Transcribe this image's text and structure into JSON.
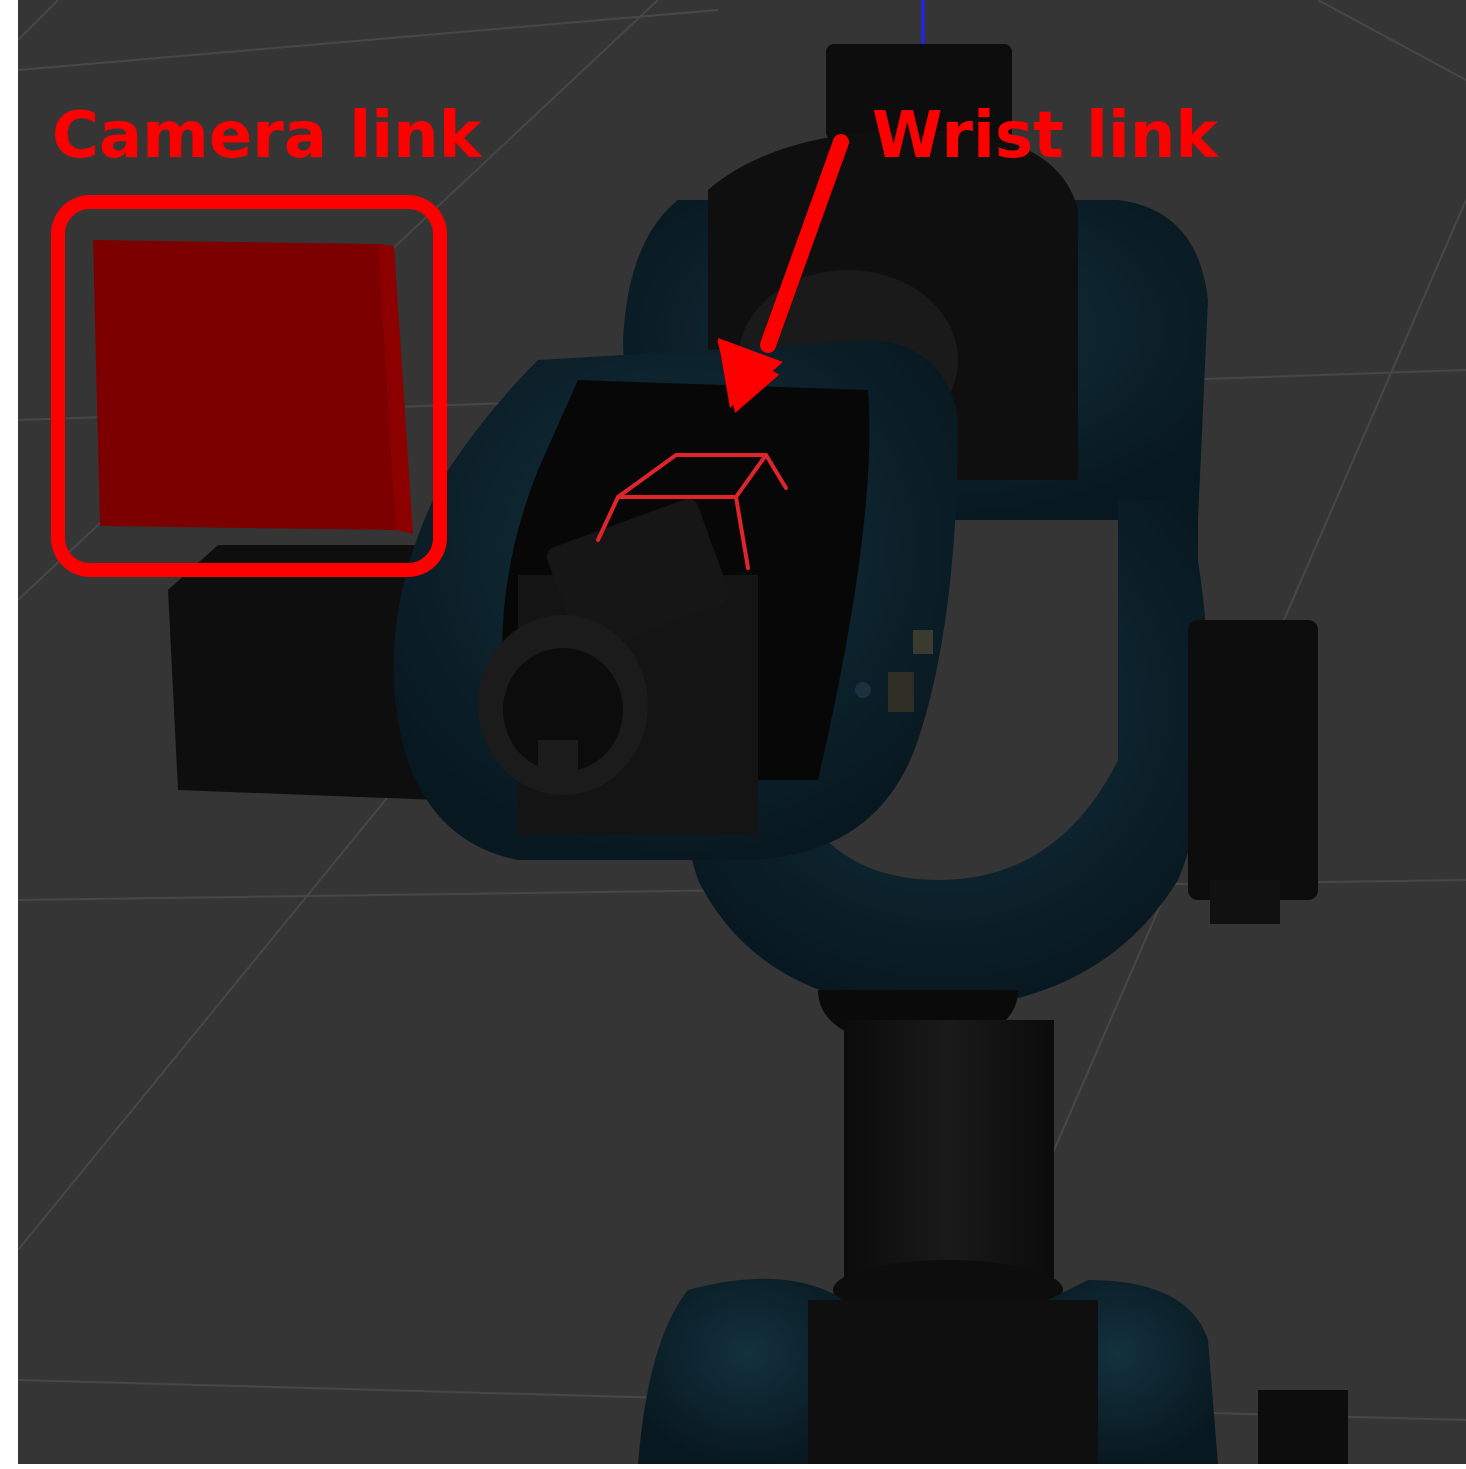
{
  "annotations": {
    "camera_link_label": "Camera link",
    "wrist_link_label": "Wrist link"
  },
  "colors": {
    "annotation": "#ff0000",
    "background": "#353535",
    "robot_shell": "#0f2732",
    "robot_dark": "#111111",
    "camera_box": "#7d0000",
    "axis_line": "#2020ff"
  }
}
